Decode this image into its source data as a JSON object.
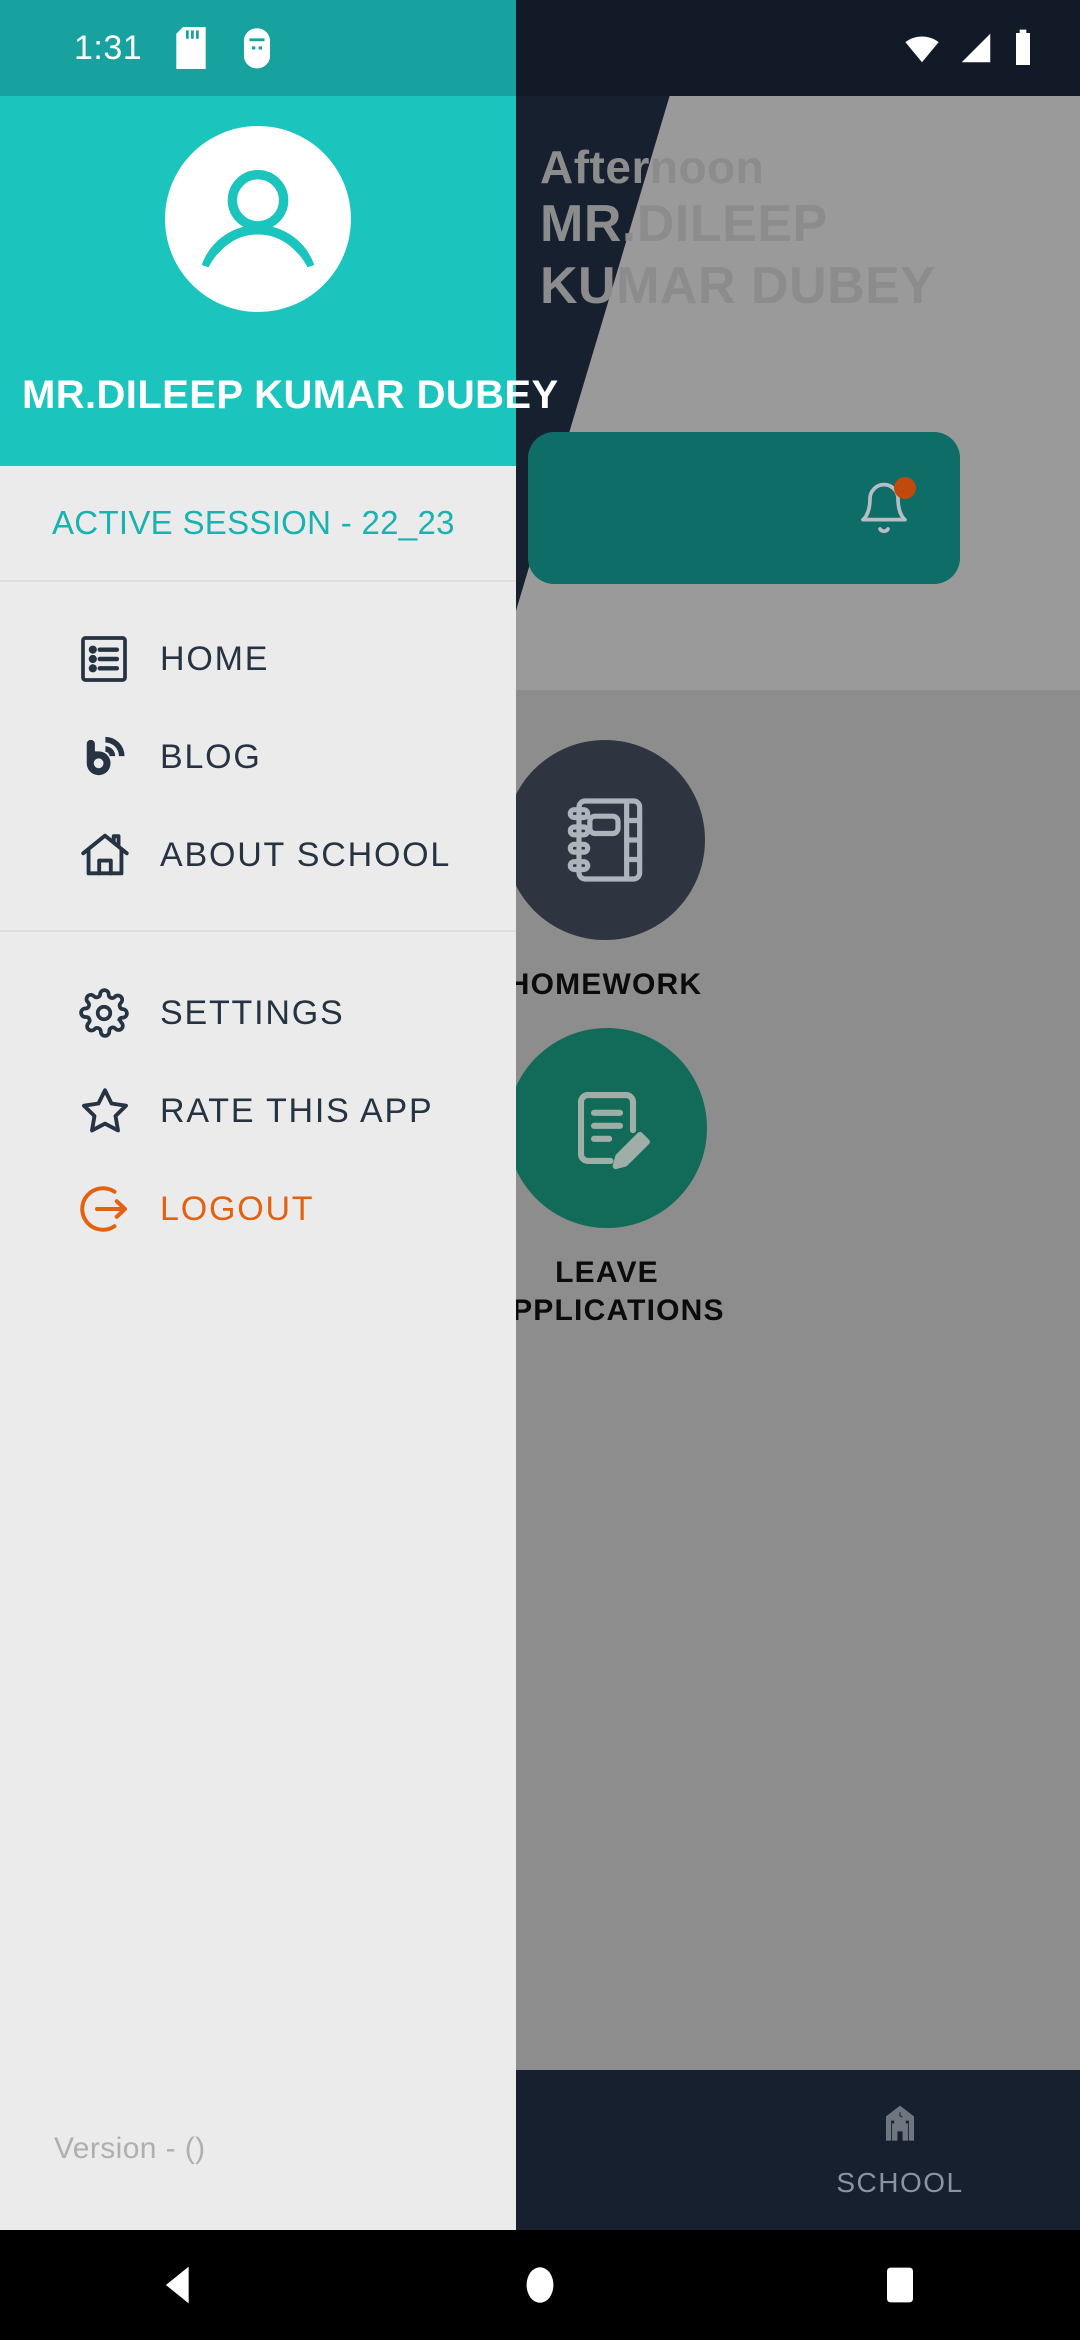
{
  "status_bar": {
    "clock": "1:31",
    "left_icons": [
      "sd-card-icon",
      "usb-debug-icon"
    ],
    "right_icons": [
      "wifi-icon",
      "cellular-signal-icon",
      "battery-icon"
    ]
  },
  "drawer": {
    "username": "MR.DILEEP KUMAR DUBEY",
    "avatar_icon": "user-avatar-icon",
    "session_label": "ACTIVE SESSION - 22_23",
    "primary_items": [
      {
        "label": "HOME",
        "icon": "dashboard-list-icon"
      },
      {
        "label": "BLOG",
        "icon": "blogger-rss-icon"
      },
      {
        "label": "ABOUT SCHOOL",
        "icon": "house-icon"
      }
    ],
    "secondary_items": [
      {
        "label": "SETTINGS",
        "icon": "gear-icon"
      },
      {
        "label": "RATE THIS APP",
        "icon": "star-icon"
      },
      {
        "label": "LOGOUT",
        "icon": "logout-arrow-icon"
      }
    ],
    "version_text": "Version -  ()"
  },
  "background_app": {
    "greeting_line1": "Afternoon",
    "greeting_line2": "MR.DILEEP",
    "greeting_line3": "KUMAR DUBEY",
    "notification_icon": "bell-icon",
    "tiles": [
      {
        "label": "HOMEWORK",
        "icon": "notebook-icon"
      },
      {
        "label": "LEAVE\nAPPLICATIONS",
        "icon": "document-pencil-icon"
      }
    ],
    "bottom_nav": [
      {
        "label": "SCHOOL",
        "icon": "school-building-icon"
      }
    ]
  },
  "android_nav": {
    "back": "back-triangle-icon",
    "home": "home-circle-icon",
    "recents": "recents-square-icon"
  },
  "colors": {
    "drawer_header_teal": "#1CC4BE",
    "status_bar_teal": "#17A2A0",
    "drawer_bg": "#EBEBEB",
    "session_teal": "#18B2B0",
    "menu_text": "#253342",
    "logout_orange": "#E2620F",
    "bg_navy": "#17202F",
    "notif_card_teal": "#0E6D66",
    "homework_circle": "#2E3440",
    "leave_circle": "#126B58",
    "scrim_gray": "#8D8D8D",
    "badge_orange": "#C0490B"
  }
}
